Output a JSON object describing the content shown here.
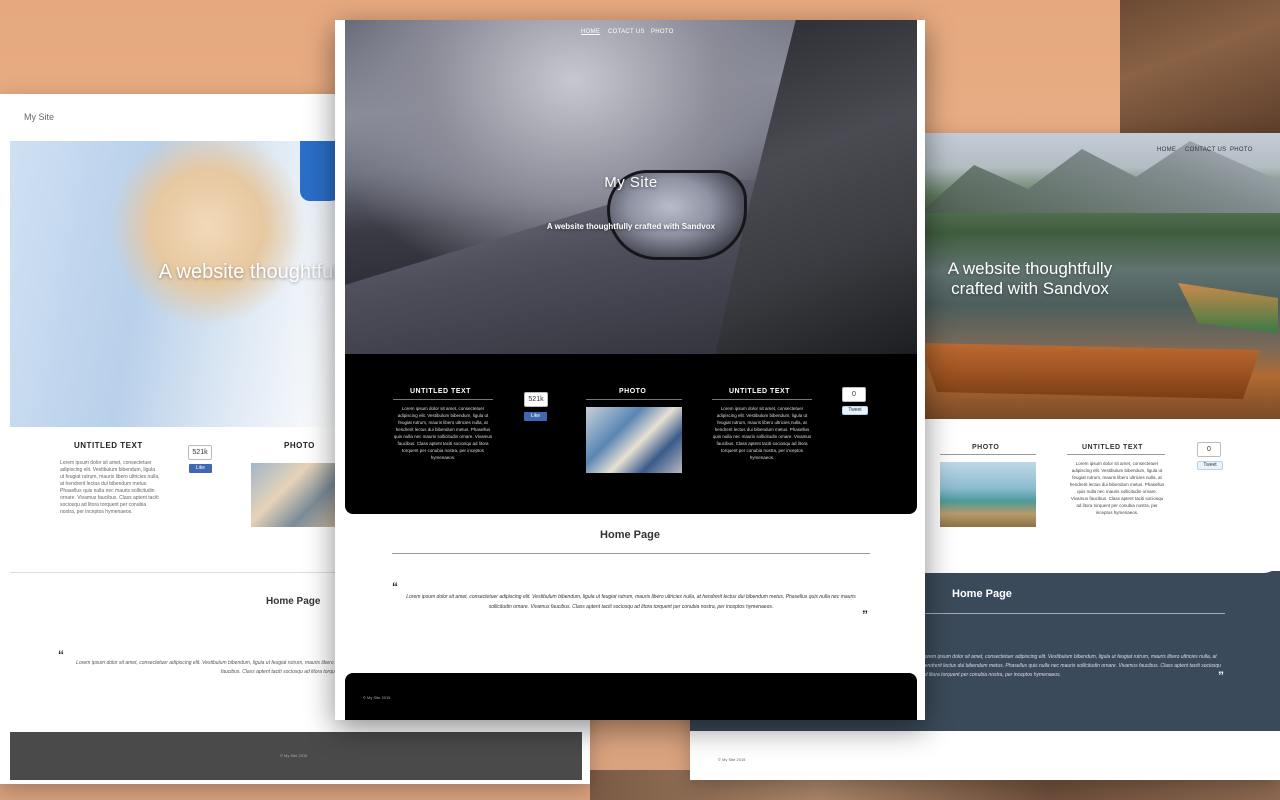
{
  "left_site": {
    "brand": "My Site",
    "hero_text": "A website thoughtfully crafted with Sandvox",
    "col1": {
      "title": "UNTITLED TEXT",
      "body": "Lorem ipsum dolor sit amet, consectetuer adipiscing elit. Vestibulum bibendum, ligula ut feugiat rutrum, mauris libero ultricies nulla, at hendrerit lectus dui bibendum metus. Phasellus quis nulla nec mauris sollicitudin ornare. Vivamus faucibus. Class aptent taciti sociosqu ad litora torquent per conubia nostra, per inceptos hymenaeos."
    },
    "like_count": "521k",
    "like_label": "Like",
    "col2_title": "PHOTO",
    "home_title": "Home Page",
    "quote_mark": "“",
    "quote": "Lorem ipsum dolor sit amet, consectetuer adipiscing elit. Vestibulum bibendum, ligula ut feugiat rutrum, mauris libero ultricies nulla, at hendrerit lectus dui bibendum metus. Phasellus quis nulla nec mauris sollicitudin ornare. Vivamus faucibus. Class aptent taciti sociosqu ad litora torquent per conubia nostra, per inceptos hymenaeos.",
    "footer": "© My Site 2015"
  },
  "right_site": {
    "nav": [
      "HOME",
      "CONTACT US",
      "PHOTO"
    ],
    "hero_text": "A website thoughtfully crafted with Sandvox",
    "col_photo_title": "PHOTO",
    "col_text": {
      "title": "UNTITLED TEXT",
      "body": "Lorem ipsum dolor sit amet, consectetuer adipiscing elit. Vestibulum bibendum, ligula ut feugiat rutrum, mauris libero ultricies nulla, at hendrerit lectus dui bibendum metus. Phasellus quis nulla nec mauris sollicitudin ornare. Vivamus faucibus. Class aptent taciti sociosqu ad litora torquent per conubia nostra, per inceptos hymenaeos."
    },
    "tweet_count": "0",
    "tweet_label": "Tweet",
    "home_title": "Home Page",
    "quote": "Lorem ipsum dolor sit amet, consectetuer adipiscing elit. Vestibulum bibendum, ligula ut feugiat rutrum, mauris libero ultricies nulla, at hendrerit lectus dui bibendum metus. Phasellus quis nulla nec mauris sollicitudin ornare. Vivamus faucibus. Class aptent taciti sociosqu ad litora torquent per conubia nostra, per inceptos hymenaeos.",
    "quote_close": "”",
    "footer": "© My Site 2015"
  },
  "center_site": {
    "nav": [
      "HOME",
      "COTACT US",
      "PHOTO"
    ],
    "hero_title": "My Site",
    "hero_subtitle": "A website thoughtfully crafted with Sandvox",
    "col1": {
      "title": "UNTITLED TEXT",
      "body": "Lorem ipsum dolor sit amet, consectetuer adipiscing elit. Vestibulum bibendum, ligula ut feugiat rutrum, mauris libero ultricies nulla, at hendrerit lectus dui bibendum metus. Phasellus quis nulla nec mauris sollicitudin ornare. Vivamus faucibus. Class aptent taciti sociosqu ad litora torquent per conubia nostra, per inceptos hymenaeos."
    },
    "like_count": "521k",
    "like_label": "Like",
    "col2_title": "PHOTO",
    "col3": {
      "title": "UNTITLED TEXT",
      "body": "Lorem ipsum dolor sit amet, consectetuer adipiscing elit. Vestibulum bibendum, ligula ut feugiat rutrum, mauris libero ultricies nulla, at hendrerit lectus dui bibendum metus. Phasellus quis nulla nec mauris sollicitudin ornare. Vivamus faucibus. Class aptent taciti sociosqu ad litora torquent per conubia nostra, per inceptos hymenaeos."
    },
    "tweet_count": "0",
    "tweet_label": "Tweet",
    "home_title": "Home Page",
    "quote_open": "“",
    "quote": "Lorem ipsum dolor sit amet, consectetuer adipiscing elit. Vestibulum bibendum, ligula ut feugiat rutrum, mauris libero ultricies nulla, at hendrerit lectus dui bibendum metus. Phasellus quis nulla nec mauris sollicitudin ornare. Vivamus faucibus. Class aptent taciti sociosqu ad litora torquent per conubia nostra, per inceptos hymenaeos.",
    "quote_close": "”",
    "footer": "© My Site 2015"
  }
}
